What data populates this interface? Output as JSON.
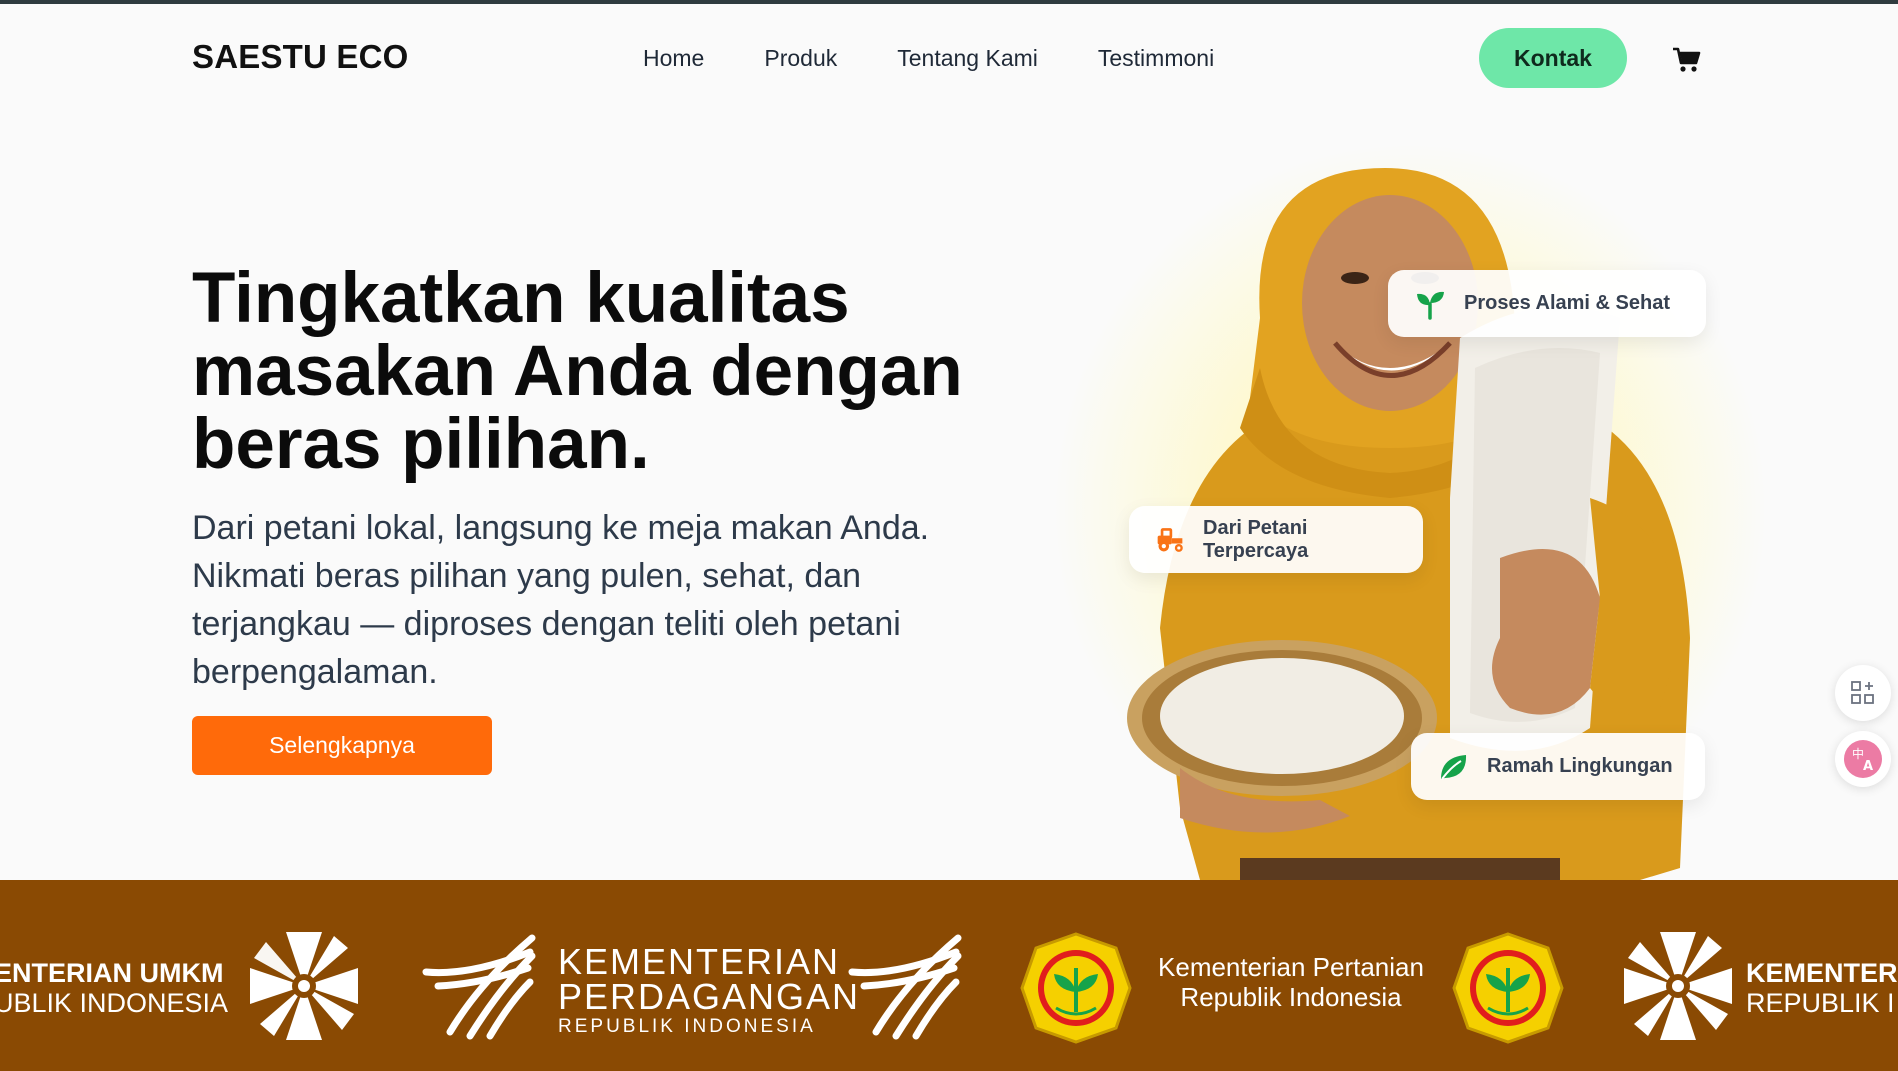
{
  "nav": {
    "brand": "SAESTU ECO",
    "items": [
      {
        "label": "Home"
      },
      {
        "label": "Produk"
      },
      {
        "label": "Tentang Kami"
      },
      {
        "label": "Testimmoni"
      }
    ],
    "contact_label": "Kontak",
    "cart_icon": "cart-icon"
  },
  "hero": {
    "title": "Tingkatkan kualitas masakan Anda dengan beras pilihan.",
    "subtitle": "Dari petani lokal, langsung ke meja makan Anda. Nikmati beras pilihan yang pulen, sehat, dan terjangkau — diproses dengan teliti oleh petani berpengalaman.",
    "cta_label": "Selengkapnya"
  },
  "badges": [
    {
      "label": "Proses Alami & Sehat",
      "icon": "sprout-icon"
    },
    {
      "label": "Dari Petani Terpercaya",
      "icon": "tractor-icon"
    },
    {
      "label": "Ramah Lingkungan",
      "icon": "leaf-icon"
    }
  ],
  "logos": {
    "umkm_line1": "ENTERIAN UMKM",
    "umkm_line2": "UBLIK INDONESIA",
    "dag_line1": "KEMENTERIAN",
    "dag_line2": "PERDAGANGAN",
    "dag_line3": "REPUBLIK INDONESIA",
    "tan_line1": "Kementerian Pertanian",
    "tan_line2": "Republik Indonesia",
    "umkm2_line1": "KEMENTER",
    "umkm2_line2": "REPUBLIK I"
  },
  "colors": {
    "accent_green": "#6ee7a8",
    "cta_orange": "#ff6a0a",
    "strip_brown": "#8a4a03",
    "hijab_mustard": "#e2a321"
  }
}
